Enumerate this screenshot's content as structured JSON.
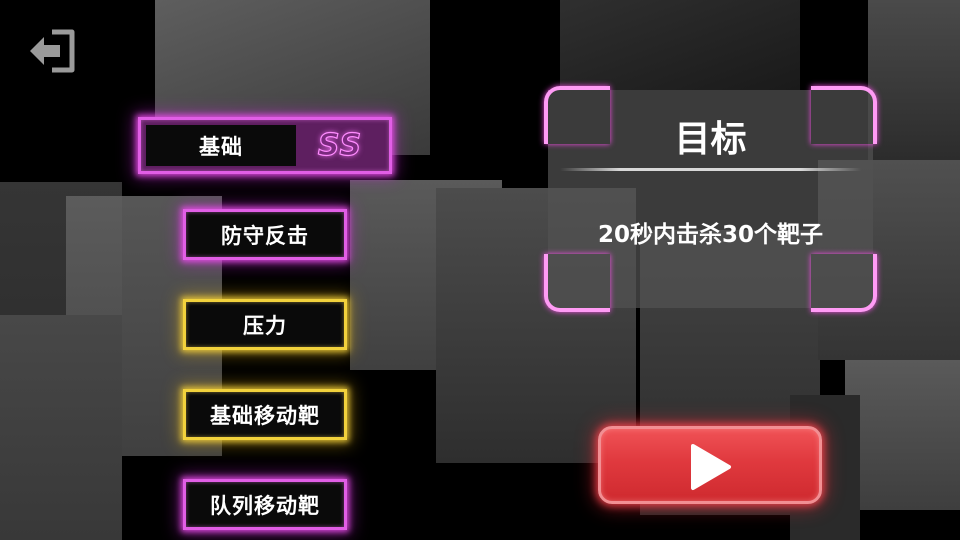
{
  "header": {
    "exit_icon": "exit-arrow-icon"
  },
  "modes": [
    {
      "label": "基础",
      "rank": "SS",
      "state": "selected",
      "color": "#e15ee6"
    },
    {
      "label": "防守反击",
      "state": "unlocked",
      "color": "#e15ee6"
    },
    {
      "label": "压力",
      "state": "highlighted",
      "color": "#f2d23c"
    },
    {
      "label": "基础移动靶",
      "state": "highlighted",
      "color": "#f2d23c"
    },
    {
      "label": "队列移动靶",
      "state": "unlocked",
      "color": "#e15ee6"
    }
  ],
  "goal": {
    "title": "目标",
    "description": "20秒内击杀30个靶子"
  },
  "play": {
    "icon": "play-icon",
    "color": "#e0393e"
  },
  "colors": {
    "pink_neon": "#e15ee6",
    "gold_neon": "#f2d23c",
    "corner_neon": "#ff9bf5",
    "play_red": "#e0393e"
  }
}
